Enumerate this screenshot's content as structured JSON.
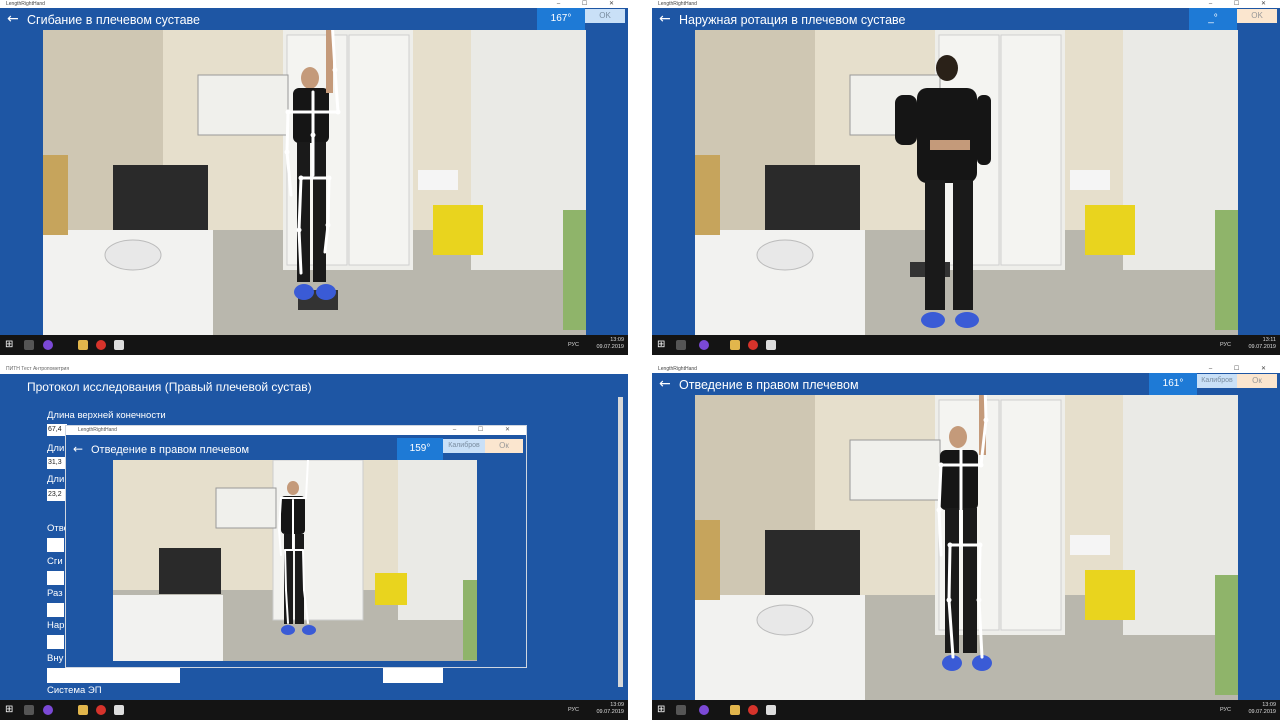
{
  "q1": {
    "window_title": "LengthRightHand",
    "title": "Сгибание в плечевом суставе",
    "angle": "167°",
    "ok_label": "OK",
    "clock_time": "13:09",
    "clock_date": "09.07.2019",
    "lang": "РУС"
  },
  "q2": {
    "window_title": "LengthRightHand",
    "title": "Наружная ротация в плечевом суставе",
    "angle": "_°",
    "ok_label": "OK",
    "clock_time": "13:11",
    "clock_date": "09.07.2019",
    "lang": "РУС"
  },
  "q3": {
    "window_title": "ПИТН Тест Антропометрия",
    "protocol_title": "Протокол исследования (Правый плечевой сустав)",
    "upper_limb_label": "Длина верхней конечности",
    "upper_limb_value": "67,4",
    "field2_label": "Дли",
    "field2_value": "31,3",
    "field3_label": "Дли",
    "field3_value": "23,2",
    "row_labels": [
      "Отве",
      "Сги",
      "Раз",
      "Нар",
      "Вну"
    ],
    "system_label": "Система ЭП",
    "inner_window_title": "LengthRightHand",
    "inner_title": "Отведение в правом плечевом",
    "inner_angle": "159°",
    "inner_calib": "Калибров",
    "inner_ok": "Ок",
    "clock_time": "13:09",
    "clock_date": "09.07.2019",
    "lang": "РУС"
  },
  "q4": {
    "window_title": "LengthRightHand",
    "title": "Отведение в правом плечевом",
    "angle": "161°",
    "calib_label": "Калибров",
    "ok_label": "Ок",
    "clock_time": "13:09",
    "clock_date": "09.07.2019",
    "lang": "РУС"
  },
  "colors": {
    "app_blue": "#1e56a4",
    "angle_blue": "#1e7ad6",
    "taskbar": "#141414",
    "skeleton": "#ffffff"
  }
}
